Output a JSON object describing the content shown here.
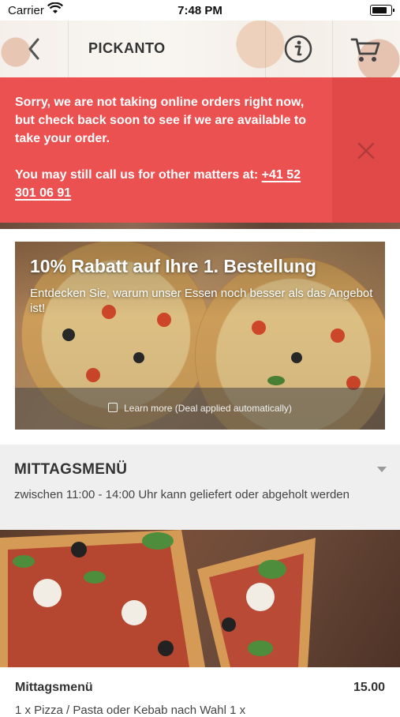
{
  "status_bar": {
    "carrier": "Carrier",
    "time": "7:48 PM"
  },
  "nav": {
    "title": "PICKANTO"
  },
  "alert": {
    "message": "Sorry, we are not taking online orders right now, but check back soon to see if we are available to take your order.",
    "call_prefix": "You may still call us for other matters at: ",
    "phone": "+41 52 301 06 91"
  },
  "promo": {
    "title": "10% Rabatt auf Ihre 1. Bestellung",
    "subtitle": "Entdecken Sie, warum unser Essen noch besser als das Angebot ist!",
    "learn_more": "Learn more (Deal applied automatically)"
  },
  "section": {
    "title": "MITTAGSMENÜ",
    "description": "zwischen 11:00 - 14:00 Uhr kann geliefert oder abgeholt werden"
  },
  "menu_item": {
    "name": "Mittagsmenü",
    "price": "15.00",
    "description": "1 x Pizza / Pasta oder Kebab nach Wahl 1 x"
  },
  "colors": {
    "alert_bg": "#ec5151",
    "alert_close_bg": "#e14848"
  }
}
